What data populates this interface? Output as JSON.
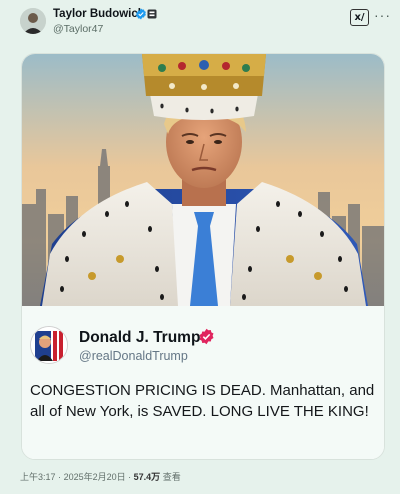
{
  "post": {
    "author": {
      "name": "Taylor Budowich",
      "handle": "@Taylor47"
    },
    "xai_label": "x/",
    "more_label": "···",
    "meta": {
      "time": "上午3:17",
      "separator": "·",
      "date": "2025年2月20日",
      "views": "57.4万",
      "views_label": "查看"
    }
  },
  "quoted": {
    "name": "Donald J. Trump",
    "handle": "@realDonaldTrump",
    "text": "CONGESTION PRICING IS DEAD. Manhattan, and all of New York, is SAVED. LONG LIVE THE KING!"
  },
  "colors": {
    "background": "#e6f2ec",
    "verified_blue": "#1d9bf0",
    "verified_pink": "#e0245e"
  }
}
